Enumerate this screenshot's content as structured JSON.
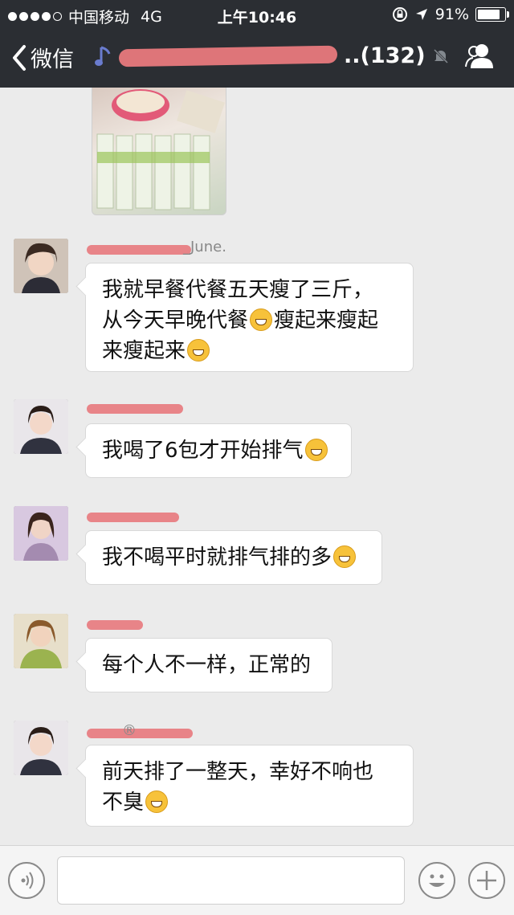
{
  "status_bar": {
    "carrier": "中国移动",
    "network": "4G",
    "time": "上午10:46",
    "battery": "91%",
    "battery_level": 0.91
  },
  "nav": {
    "back_label": "微信",
    "title_count": "..(132)"
  },
  "messages": [
    {
      "sender_visible": "_June.",
      "lines": [
        "我就早餐代餐五天瘦了三斤，",
        "从今天早晚代餐",
        "瘦起来瘦起",
        "来瘦起来"
      ]
    },
    {
      "lines": [
        "我喝了6包才开始排气"
      ]
    },
    {
      "lines": [
        "我不喝平时就排气排的多"
      ]
    },
    {
      "lines": [
        "每个人不一样，正常的"
      ]
    },
    {
      "sender_visible": "®",
      "lines": [
        "前天排了一整天，幸好不响也",
        "不臭"
      ]
    }
  ],
  "input": {
    "placeholder": ""
  },
  "icons": {
    "back": "chevron-left-icon",
    "music": "music-note-icon",
    "mute": "mute-bell-icon",
    "contacts": "people-icon",
    "voice": "voice-icon",
    "emoji": "smiley-icon",
    "plus": "plus-icon"
  }
}
